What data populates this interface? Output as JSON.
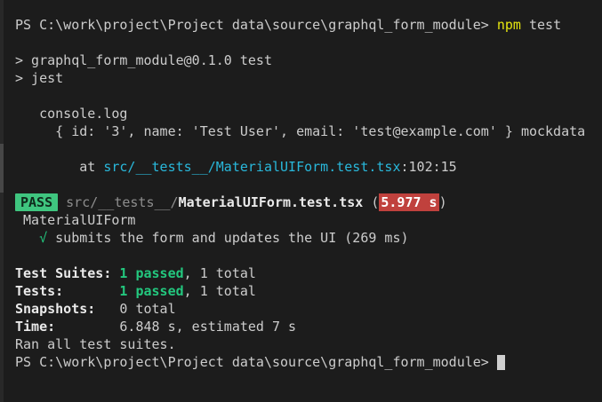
{
  "colors": {
    "background": "#1c1c1c",
    "foreground": "#cccccc",
    "bold_white": "#eaeaea",
    "yellow": "#e5e510",
    "cyan": "#29b8db",
    "dim": "#8d8d8d",
    "green": "#23c77e",
    "pass_badge_bg": "#3fc57f",
    "pass_badge_fg": "#0f2a1c",
    "time_badge_bg": "#c0413d",
    "time_badge_fg": "#ffffff",
    "cursor": "#cfcfcf"
  },
  "terminal": {
    "shell": "PowerShell",
    "working_directory": "C:\\work\\project\\Project data\\source\\graphql_form_module",
    "command": "npm test",
    "lines": [
      {
        "name": "prompt-line-command",
        "segments": [
          {
            "text": "PS C:\\work\\project\\Project data\\source\\graphql_form_module> ",
            "style": "default"
          },
          {
            "text": "npm",
            "style": "yellow"
          },
          {
            "text": " test",
            "style": "default"
          }
        ]
      },
      {
        "name": "blank-line",
        "segments": []
      },
      {
        "name": "npm-script-line",
        "segments": [
          {
            "text": "> graphql_form_module@0.1.0 test",
            "style": "default"
          }
        ]
      },
      {
        "name": "jest-command-line",
        "segments": [
          {
            "text": "> jest",
            "style": "default"
          }
        ]
      },
      {
        "name": "blank-line",
        "segments": []
      },
      {
        "name": "console-log-label",
        "segments": [
          {
            "text": "   console.log",
            "style": "default"
          }
        ]
      },
      {
        "name": "console-log-output",
        "segments": [
          {
            "text": "     { id: '3', name: 'Test User', email: 'test@example.com' } mockdata",
            "style": "default"
          }
        ]
      },
      {
        "name": "blank-line",
        "segments": []
      },
      {
        "name": "stack-location-line",
        "segments": [
          {
            "text": "        at ",
            "style": "default"
          },
          {
            "text": "src/__tests__/MaterialUIForm.test.tsx",
            "style": "cyan"
          },
          {
            "text": ":102:15",
            "style": "default"
          }
        ]
      },
      {
        "name": "blank-line",
        "segments": []
      },
      {
        "name": "pass-result-line",
        "segments": [
          {
            "text": "PASS",
            "style": "passBadge"
          },
          {
            "text": " ",
            "style": "default"
          },
          {
            "text": "src/__tests__/",
            "style": "dim"
          },
          {
            "text": "MaterialUIForm.test.tsx",
            "style": "boldWhite"
          },
          {
            "text": " (",
            "style": "default"
          },
          {
            "text": "5.977 s",
            "style": "timeBadge"
          },
          {
            "text": ")",
            "style": "default"
          }
        ]
      },
      {
        "name": "describe-title-line",
        "segments": [
          {
            "text": " MaterialUIForm",
            "style": "default"
          }
        ]
      },
      {
        "name": "test-case-result-line",
        "segments": [
          {
            "text": "   ",
            "style": "default"
          },
          {
            "text": "√",
            "style": "green"
          },
          {
            "text": " submits the form and updates the UI (269 ms)",
            "style": "default"
          }
        ]
      },
      {
        "name": "blank-line",
        "segments": []
      },
      {
        "name": "summary-suites-line",
        "segments": [
          {
            "text": "Test Suites: ",
            "style": "boldWhite"
          },
          {
            "text": "1 passed",
            "style": "greenBold"
          },
          {
            "text": ", 1 total",
            "style": "default"
          }
        ]
      },
      {
        "name": "summary-tests-line",
        "segments": [
          {
            "text": "Tests:       ",
            "style": "boldWhite"
          },
          {
            "text": "1 passed",
            "style": "greenBold"
          },
          {
            "text": ", 1 total",
            "style": "default"
          }
        ]
      },
      {
        "name": "summary-snapshots-line",
        "segments": [
          {
            "text": "Snapshots:   ",
            "style": "boldWhite"
          },
          {
            "text": "0 total",
            "style": "default"
          }
        ]
      },
      {
        "name": "summary-time-line",
        "segments": [
          {
            "text": "Time:        ",
            "style": "boldWhite"
          },
          {
            "text": "6.848 s, estimated 7 s",
            "style": "default"
          }
        ]
      },
      {
        "name": "summary-ran-line",
        "segments": [
          {
            "text": "Ran all test suites.",
            "style": "default"
          }
        ]
      },
      {
        "name": "prompt-line-final",
        "cursor": true,
        "segments": [
          {
            "text": "PS C:\\work\\project\\Project data\\source\\graphql_form_module> ",
            "style": "default"
          }
        ]
      }
    ]
  }
}
